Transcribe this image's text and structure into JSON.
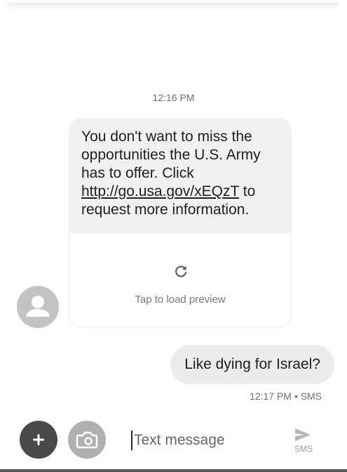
{
  "conversation": {
    "incoming": {
      "time": "12:16 PM",
      "text_before_link": "You don't want to miss the opportunities the U.S. Army has to offer.  Click ",
      "link": "http://go.usa.gov/xEQzT",
      "text_after_link": " to request more information.",
      "preview_label": "Tap to load preview",
      "preview_icon": "reload-icon",
      "avatar_icon": "person-icon"
    },
    "outgoing": {
      "text": "Like dying for Israel?",
      "meta": "12:17 PM • SMS"
    }
  },
  "compose": {
    "placeholder": "Text message",
    "send_label": "SMS",
    "add_icon": "plus-icon",
    "camera_icon": "camera-icon",
    "send_icon": "send-icon"
  },
  "colors": {
    "bubble_incoming": "#f1f1f1",
    "bubble_outgoing": "#ececec",
    "avatar": "#c3c3c3",
    "plus_button": "#4a4a4a",
    "camera_button": "#b0b0b0"
  }
}
